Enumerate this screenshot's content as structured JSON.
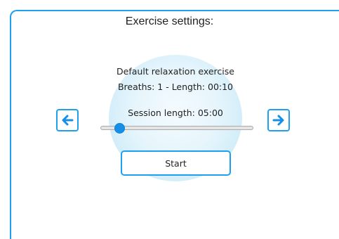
{
  "header": {
    "title": "Exercise settings:"
  },
  "exercise": {
    "name": "Default relaxation exercise",
    "details": "Breaths: 1 - Length: 00:10"
  },
  "session": {
    "label": "Session length: 05:00",
    "slider_fraction": 0.1
  },
  "navigation": {
    "prev_icon": "arrow-left-icon",
    "next_icon": "arrow-right-icon"
  },
  "actions": {
    "start_label": "Start"
  },
  "colors": {
    "accent": "#1ea0f0",
    "slider_thumb": "#1590e6",
    "glow": "#cdebf8"
  }
}
